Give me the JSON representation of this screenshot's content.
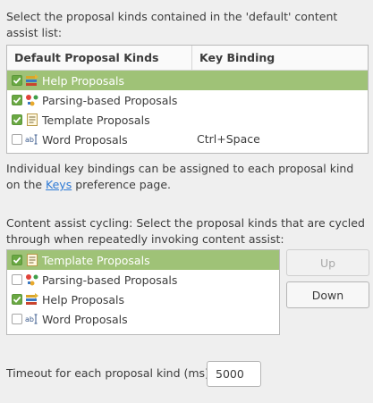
{
  "intro_text": "Select the proposal kinds contained in the 'default' content assist list:",
  "table": {
    "col_kinds": "Default Proposal Kinds",
    "col_binding": "Key Binding",
    "rows": [
      {
        "label": "Help Proposals",
        "checked": true,
        "icon": "help-proposals-icon",
        "binding": "",
        "selected": true
      },
      {
        "label": "Parsing-based Proposals",
        "checked": true,
        "icon": "parsing-proposals-icon",
        "binding": ""
      },
      {
        "label": "Template Proposals",
        "checked": true,
        "icon": "template-proposals-icon",
        "binding": ""
      },
      {
        "label": "Word Proposals",
        "checked": false,
        "icon": "word-proposals-icon",
        "binding": "Ctrl+Space"
      }
    ]
  },
  "keybinding_note": {
    "prefix": "Individual key bindings can be assigned to each proposal kind on the ",
    "link": "Keys",
    "suffix": " preference page."
  },
  "cycling_text": "Content assist cycling: Select the proposal kinds that are cycled through when repeatedly invoking content assist:",
  "cycling_list": [
    {
      "label": "Template Proposals",
      "checked": true,
      "icon": "template-proposals-icon",
      "selected": true
    },
    {
      "label": "Parsing-based Proposals",
      "checked": false,
      "icon": "parsing-proposals-icon"
    },
    {
      "label": "Help Proposals",
      "checked": true,
      "icon": "help-proposals-icon"
    },
    {
      "label": "Word Proposals",
      "checked": false,
      "icon": "word-proposals-icon"
    }
  ],
  "buttons": {
    "up": "Up",
    "down": "Down"
  },
  "timeout": {
    "label": "Timeout for each proposal kind (ms):",
    "value": "5000"
  },
  "colors": {
    "selection": "#9fc277",
    "checkbox_checked": "#6aa843",
    "link": "#2f7bd6"
  }
}
